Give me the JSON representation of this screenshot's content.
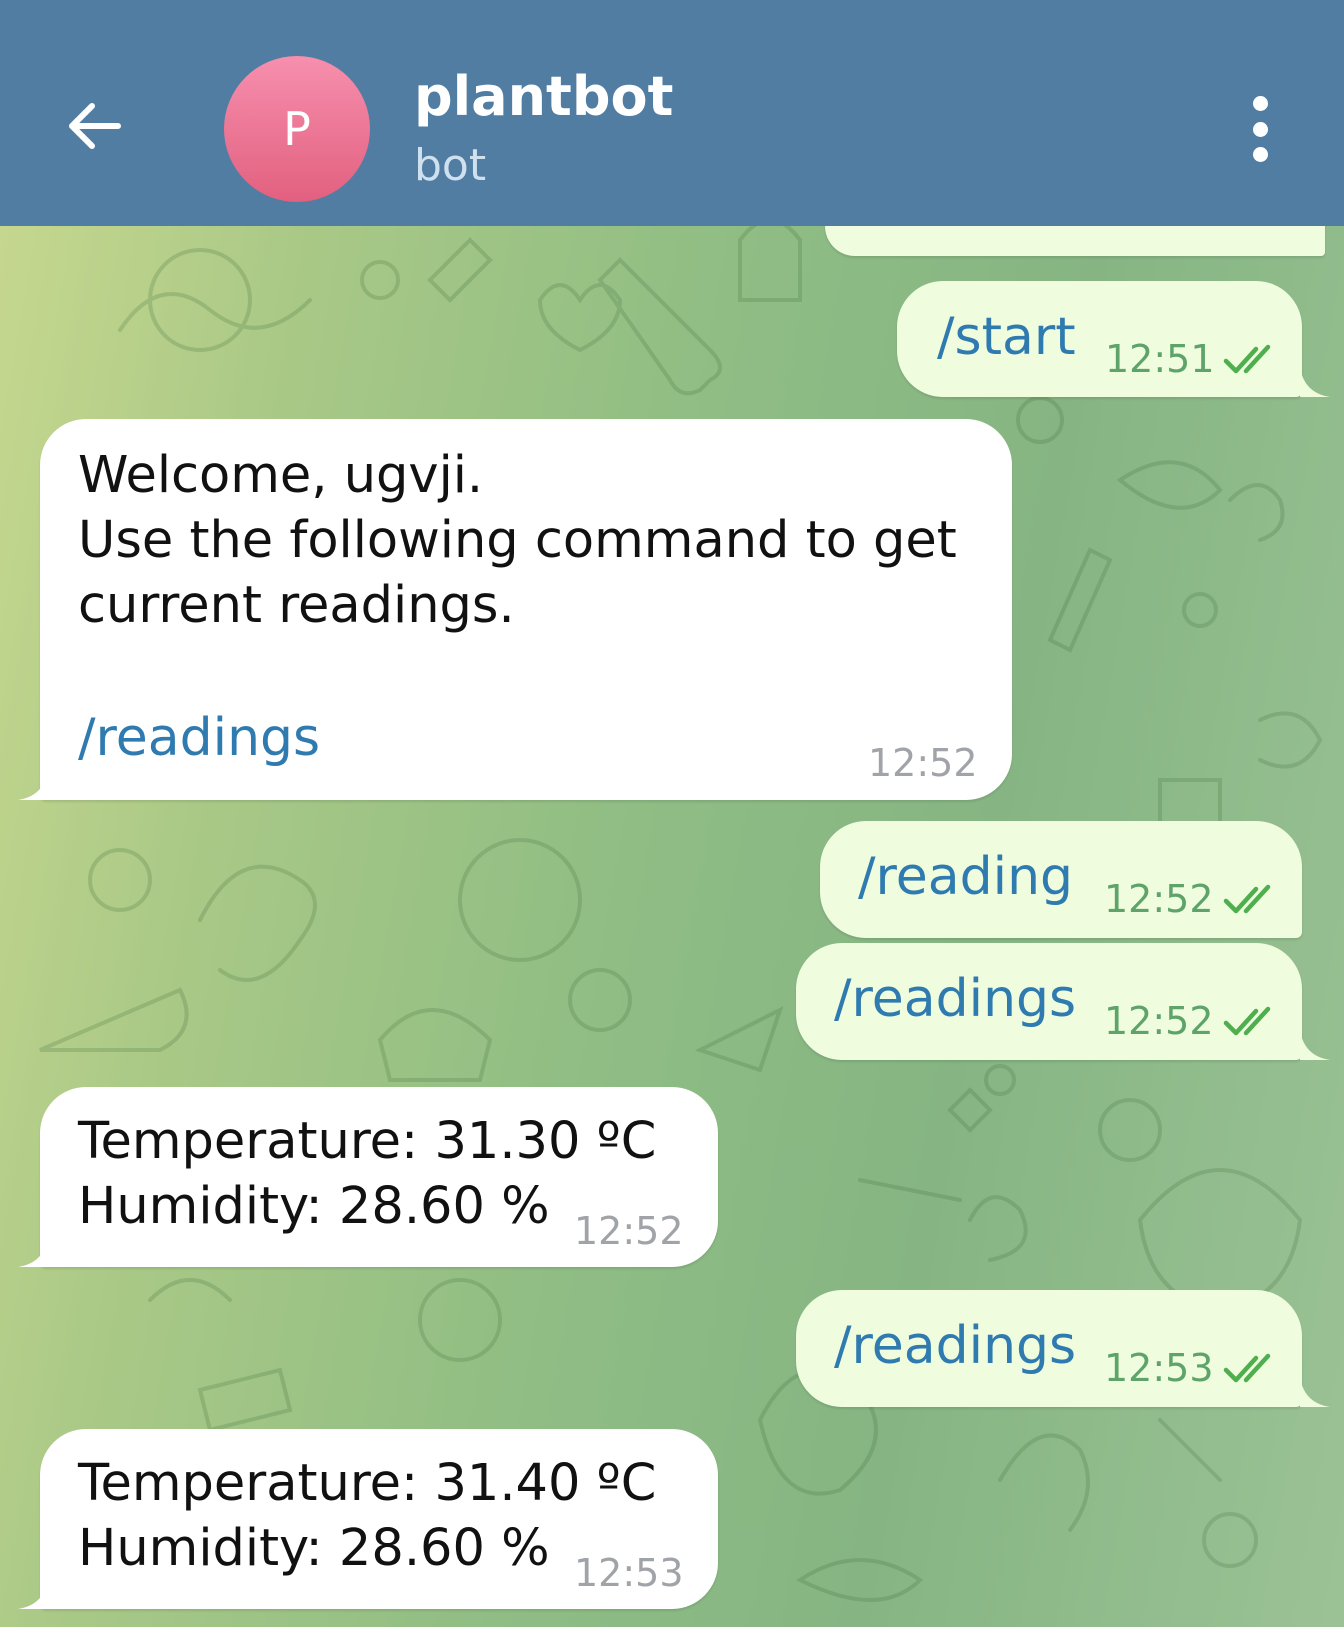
{
  "header": {
    "avatar_letter": "P",
    "title": "plantbot",
    "subtitle": "bot",
    "colors": {
      "bar": "#517da2",
      "avatar": "#e9708f"
    }
  },
  "icons": {
    "back": "arrow-left-icon",
    "menu": "more-vertical-icon",
    "read": "double-check-icon"
  },
  "messages": [
    {
      "direction": "out",
      "text": "/start",
      "time": "12:51",
      "status": "read"
    },
    {
      "direction": "in",
      "lines": [
        "Welcome, ugvji.",
        "Use the following command to get",
        "current readings."
      ],
      "command": "/readings",
      "time": "12:52"
    },
    {
      "direction": "out",
      "text": "/reading",
      "time": "12:52",
      "status": "read"
    },
    {
      "direction": "out",
      "text": "/readings",
      "time": "12:52",
      "status": "read"
    },
    {
      "direction": "in",
      "lines": [
        "Temperature: 31.30 ºC",
        "Humidity: 28.60 %"
      ],
      "time": "12:52"
    },
    {
      "direction": "out",
      "text": "/readings",
      "time": "12:53",
      "status": "read"
    },
    {
      "direction": "in",
      "lines": [
        "Temperature: 31.40 ºC",
        "Humidity: 28.60 %"
      ],
      "time": "12:53"
    }
  ]
}
